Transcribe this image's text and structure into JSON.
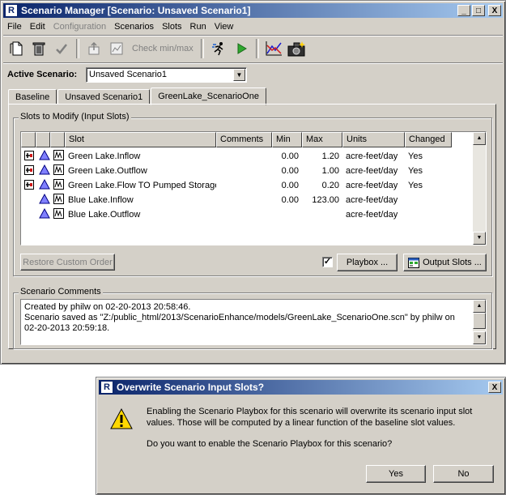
{
  "main_window": {
    "title": "Scenario Manager [Scenario: Unsaved Scenario1]",
    "title_buttons": [
      "_",
      "□",
      "X"
    ],
    "menu": [
      "File",
      "Edit",
      "Configuration",
      "Scenarios",
      "Slots",
      "Run",
      "View"
    ],
    "toolbar": {
      "check_label": "Check min/max"
    },
    "active_scenario_label": "Active Scenario:",
    "active_scenario_value": "Unsaved Scenario1",
    "tabs": [
      "Baseline",
      "Unsaved Scenario1",
      "GreenLake_ScenarioOne"
    ],
    "slots_group_label": "Slots to Modify (Input Slots)",
    "columns": [
      "Slot",
      "Comments",
      "Min",
      "Max",
      "Units",
      "Changed"
    ],
    "rows": [
      {
        "slot": "Green Lake.Inflow",
        "comments": "",
        "min": "0.00",
        "max": "1.20",
        "units": "acre-feet/day",
        "changed": "Yes"
      },
      {
        "slot": "Green Lake.Outflow",
        "comments": "",
        "min": "0.00",
        "max": "1.00",
        "units": "acre-feet/day",
        "changed": "Yes"
      },
      {
        "slot": "Green Lake.Flow TO Pumped Storage",
        "comments": "",
        "min": "0.00",
        "max": "0.20",
        "units": "acre-feet/day",
        "changed": "Yes"
      },
      {
        "slot": "Blue Lake.Inflow",
        "comments": "",
        "min": "0.00",
        "max": "123.00",
        "units": "acre-feet/day",
        "changed": ""
      },
      {
        "slot": "Blue Lake.Outflow",
        "comments": "",
        "min": "",
        "max": "",
        "units": "acre-feet/day",
        "changed": ""
      }
    ],
    "restore_button": "Restore Custom Order",
    "playbox_checked": true,
    "playbox_button": "Playbox ...",
    "output_slots_button": "Output Slots ...",
    "comments_group_label": "Scenario Comments",
    "comments_lines": [
      "Created by philw on 02-20-2013 20:58:46.",
      "Scenario saved as \"Z:/public_html/2013/ScenarioEnhance/models/GreenLake_ScenarioOne.scn\" by philw on",
      " 02-20-2013 20:59:18."
    ]
  },
  "dialog": {
    "title": "Overwrite Scenario Input Slots?",
    "close": "X",
    "message_line1": "Enabling the Scenario Playbox for this scenario will overwrite its scenario input slot",
    "message_line2": "values. Those will be computed by a linear function of the baseline slot values.",
    "message_line3": "Do you want to enable the Scenario Playbox for this scenario?",
    "yes_button": "Yes",
    "no_button": "No"
  }
}
